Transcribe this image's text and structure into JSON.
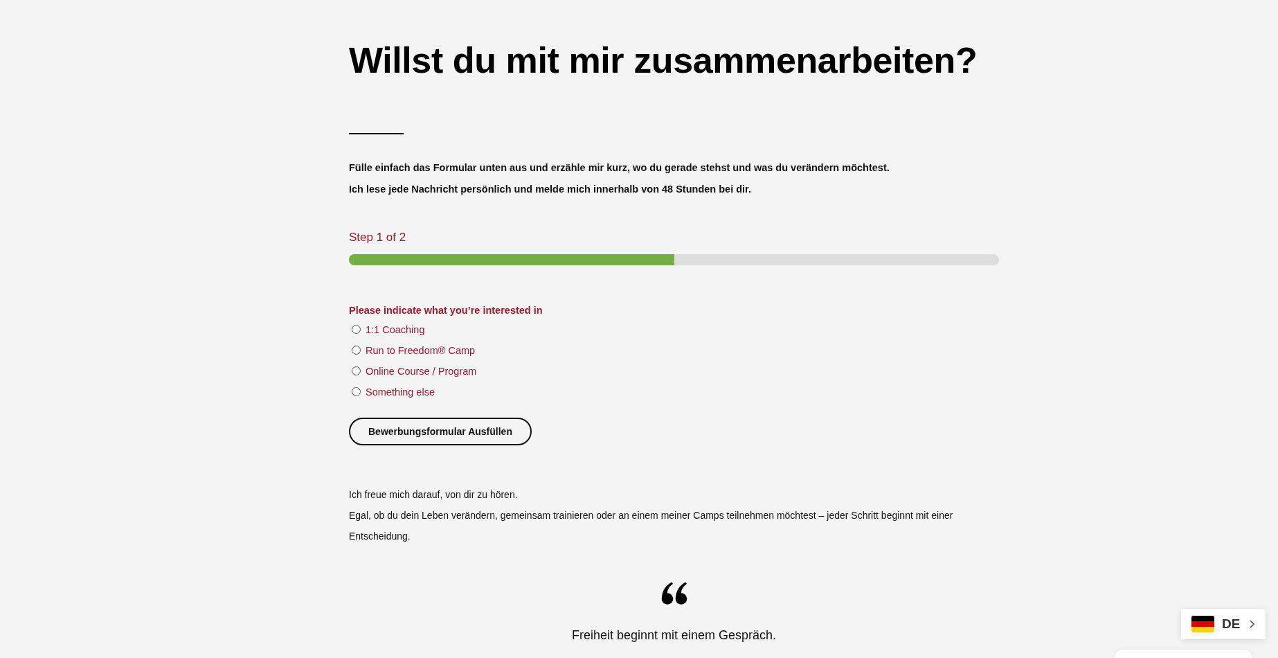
{
  "heading": "Willst du mit mir zusammenarbeiten?",
  "intro": [
    "Fülle einfach das Formular unten aus und erzähle mir kurz, wo du gerade stehst und was du verändern möchtest.",
    "Ich lese jede Nachricht persönlich und melde mich innerhalb von 48 Stunden bei dir."
  ],
  "progress": {
    "label": "Step 1 of 2",
    "level": 0.5
  },
  "question": {
    "label": "Please indicate what you’re interested in",
    "options": [
      {
        "label": "1:1 Coaching",
        "selected": false
      },
      {
        "label": "Run to Freedom® Camp",
        "selected": false
      },
      {
        "label": "Online Course / Program",
        "selected": false
      },
      {
        "label": "Something else",
        "selected": false
      }
    ]
  },
  "submit_button": "Bewerbungsformular Ausfüllen",
  "closing": [
    "Ich freue mich darauf, von dir zu hören.",
    "Egal, ob du dein Leben verändern, gemeinsam trainieren oder an einem meiner Camps teilnehmen möchtest – jeder Schritt beginnt mit einer Entscheidung."
  ],
  "quote": "Freiheit beginnt mit einem Gespräch.",
  "language_switcher": {
    "code": "DE"
  }
}
